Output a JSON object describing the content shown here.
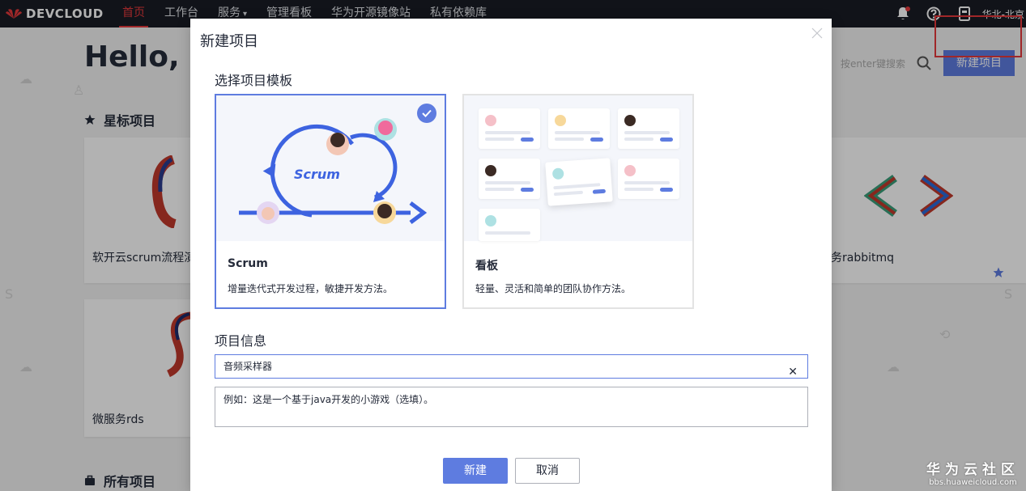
{
  "topbar": {
    "logo_text": "DEVCLOUD",
    "nav": [
      {
        "label": "首页",
        "active": true
      },
      {
        "label": "工作台"
      },
      {
        "label": "服务"
      },
      {
        "label": "管理看板"
      },
      {
        "label": "华为开源镜像站"
      },
      {
        "label": "私有依赖库"
      }
    ],
    "region": "华北-北京"
  },
  "page": {
    "greeting": "Hello, pa",
    "starred_title": "星标项目",
    "all_title": "所有项目",
    "search_placeholder": "按enter键搜索",
    "new_project_button": "新建项目",
    "cards": [
      {
        "name": "软开云scrum流程演"
      },
      {
        "name": "务rabbitmq"
      },
      {
        "name": "微服务rds"
      }
    ]
  },
  "modal": {
    "title": "新建项目",
    "template_label": "选择项目模板",
    "templates": [
      {
        "name": "Scrum",
        "desc": "增量迭代式开发过程，敏捷开发方法。",
        "art_label": "Scrum",
        "selected": true
      },
      {
        "name": "看板",
        "desc": "轻量、灵活和简单的团队协作方法。",
        "selected": false
      }
    ],
    "info_label": "项目信息",
    "name_value": "音频采样器",
    "desc_placeholder": "例如：这是一个基于java开发的小游戏（选填）。",
    "create_button": "新建",
    "cancel_button": "取消"
  },
  "watermark": {
    "line1": "华为云社区",
    "line2": "bbs.huaweicloud.com"
  },
  "colors": {
    "accent": "#5e7ce0",
    "brand_red": "#e5393c",
    "topbar": "#191c24"
  }
}
